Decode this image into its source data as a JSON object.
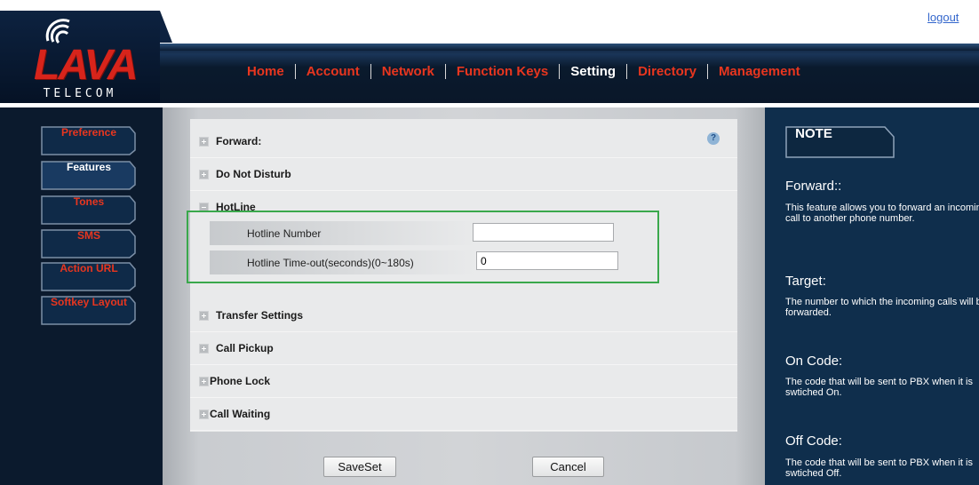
{
  "header": {
    "logo_text": "LAVA",
    "logo_sub": "TELECOM",
    "logout": "logout"
  },
  "nav": {
    "items": [
      {
        "label": "Home",
        "active": false
      },
      {
        "label": "Account",
        "active": false
      },
      {
        "label": "Network",
        "active": false
      },
      {
        "label": "Function Keys",
        "active": false
      },
      {
        "label": "Setting",
        "active": true
      },
      {
        "label": "Directory",
        "active": false
      },
      {
        "label": "Management",
        "active": false
      }
    ]
  },
  "sidebar": {
    "items": [
      {
        "label": "Preference",
        "active": false
      },
      {
        "label": "Features",
        "active": true
      },
      {
        "label": "Tones",
        "active": false
      },
      {
        "label": "SMS",
        "active": false
      },
      {
        "label": "Action URL",
        "active": false
      },
      {
        "label": "Softkey Layout",
        "active": false
      }
    ]
  },
  "main": {
    "help_icon": "?",
    "sections": [
      {
        "title": "Forward:",
        "expanded": false
      },
      {
        "title": "Do Not Disturb",
        "expanded": false
      },
      {
        "title": "HotLine",
        "expanded": true
      },
      {
        "title": "Transfer Settings",
        "expanded": false
      },
      {
        "title": "Call Pickup",
        "expanded": false
      },
      {
        "title": "Phone Lock",
        "expanded": false
      },
      {
        "title": "Call Waiting",
        "expanded": false
      }
    ],
    "hotline": {
      "number_label": "Hotline Number",
      "number_value": "",
      "timeout_label": "Hotline Time-out(seconds)(0~180s)",
      "timeout_value": "0"
    },
    "buttons": {
      "save": "SaveSet",
      "cancel": "Cancel"
    }
  },
  "note": {
    "tab": "NOTE",
    "entries": [
      {
        "head": "Forward::",
        "body": "This feature allows you to forward an incoming call to another phone number."
      },
      {
        "head": "Target:",
        "body": "The number to which the incoming calls will be forwarded."
      },
      {
        "head": "On Code:",
        "body": "The code that will be sent to PBX when it is swtiched On."
      },
      {
        "head": "Off Code:",
        "body": "The code that will be sent to PBX when it is swtiched Off."
      }
    ]
  },
  "colors": {
    "accent_red": "#e8361f",
    "nav_bg": "#0a1a2d",
    "note_bg": "#0f2e4c",
    "highlight_green": "#3aa84c"
  }
}
